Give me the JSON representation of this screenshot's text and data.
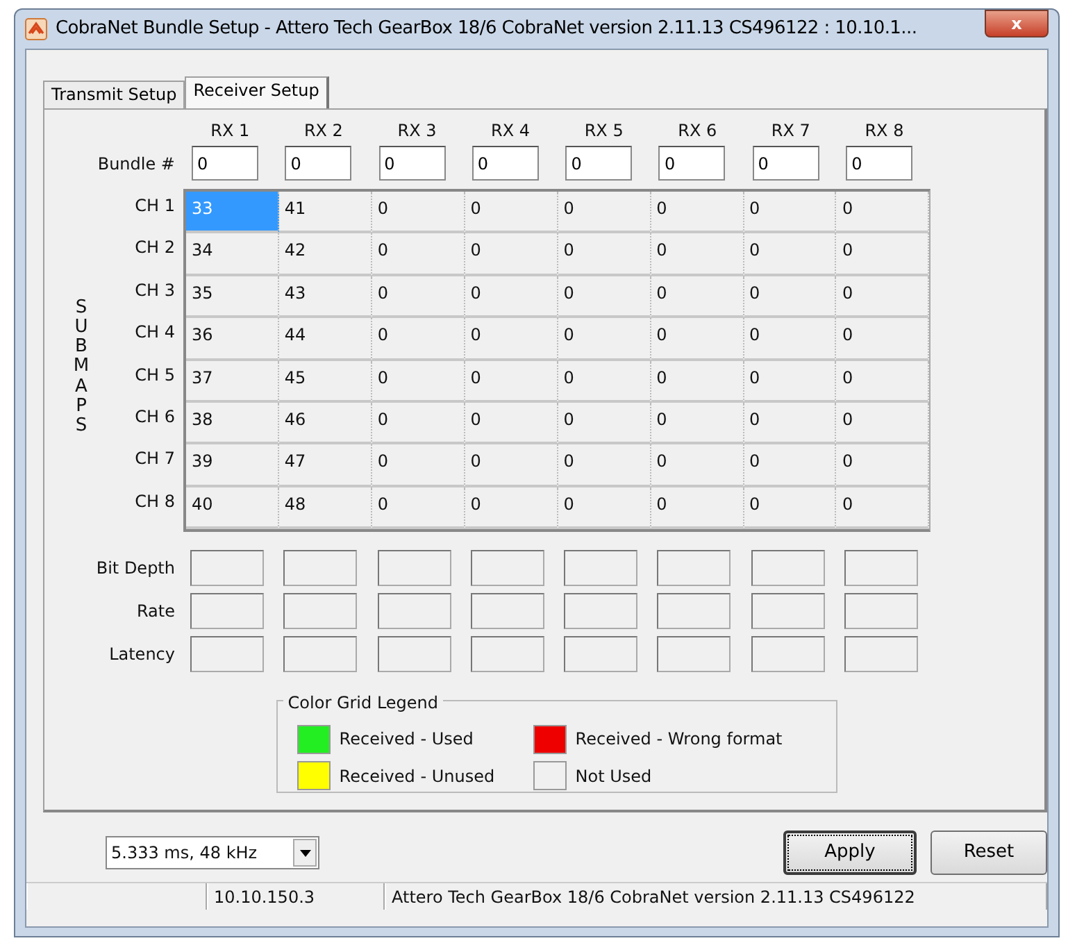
{
  "window": {
    "title": "CobraNet Bundle Setup - Attero Tech GearBox 18/6 CobraNet version 2.11.13 CS496122 : 10.10.1...",
    "close": "x"
  },
  "tabs": [
    {
      "label": "Transmit Setup",
      "selected": false
    },
    {
      "label": "Receiver Setup",
      "selected": true
    }
  ],
  "columns": [
    "RX 1",
    "RX 2",
    "RX 3",
    "RX 4",
    "RX 5",
    "RX 6",
    "RX 7",
    "RX 8"
  ],
  "bundle": {
    "label": "Bundle #",
    "values": [
      "0",
      "0",
      "0",
      "0",
      "0",
      "0",
      "0",
      "0"
    ]
  },
  "submaps": {
    "label": "SUBMAPS",
    "rows": [
      {
        "label": "CH 1",
        "cells": [
          {
            "value": "33",
            "selected": true
          },
          {
            "value": "41",
            "selected": false
          },
          {
            "value": "0",
            "selected": false
          },
          {
            "value": "0",
            "selected": false
          },
          {
            "value": "0",
            "selected": false
          },
          {
            "value": "0",
            "selected": false
          },
          {
            "value": "0",
            "selected": false
          },
          {
            "value": "0",
            "selected": false
          }
        ]
      },
      {
        "label": "CH 2",
        "cells": [
          {
            "value": "34",
            "selected": false
          },
          {
            "value": "42",
            "selected": false
          },
          {
            "value": "0",
            "selected": false
          },
          {
            "value": "0",
            "selected": false
          },
          {
            "value": "0",
            "selected": false
          },
          {
            "value": "0",
            "selected": false
          },
          {
            "value": "0",
            "selected": false
          },
          {
            "value": "0",
            "selected": false
          }
        ]
      },
      {
        "label": "CH 3",
        "cells": [
          {
            "value": "35",
            "selected": false
          },
          {
            "value": "43",
            "selected": false
          },
          {
            "value": "0",
            "selected": false
          },
          {
            "value": "0",
            "selected": false
          },
          {
            "value": "0",
            "selected": false
          },
          {
            "value": "0",
            "selected": false
          },
          {
            "value": "0",
            "selected": false
          },
          {
            "value": "0",
            "selected": false
          }
        ]
      },
      {
        "label": "CH 4",
        "cells": [
          {
            "value": "36",
            "selected": false
          },
          {
            "value": "44",
            "selected": false
          },
          {
            "value": "0",
            "selected": false
          },
          {
            "value": "0",
            "selected": false
          },
          {
            "value": "0",
            "selected": false
          },
          {
            "value": "0",
            "selected": false
          },
          {
            "value": "0",
            "selected": false
          },
          {
            "value": "0",
            "selected": false
          }
        ]
      },
      {
        "label": "CH 5",
        "cells": [
          {
            "value": "37",
            "selected": false
          },
          {
            "value": "45",
            "selected": false
          },
          {
            "value": "0",
            "selected": false
          },
          {
            "value": "0",
            "selected": false
          },
          {
            "value": "0",
            "selected": false
          },
          {
            "value": "0",
            "selected": false
          },
          {
            "value": "0",
            "selected": false
          },
          {
            "value": "0",
            "selected": false
          }
        ]
      },
      {
        "label": "CH 6",
        "cells": [
          {
            "value": "38",
            "selected": false
          },
          {
            "value": "46",
            "selected": false
          },
          {
            "value": "0",
            "selected": false
          },
          {
            "value": "0",
            "selected": false
          },
          {
            "value": "0",
            "selected": false
          },
          {
            "value": "0",
            "selected": false
          },
          {
            "value": "0",
            "selected": false
          },
          {
            "value": "0",
            "selected": false
          }
        ]
      },
      {
        "label": "CH 7",
        "cells": [
          {
            "value": "39",
            "selected": false
          },
          {
            "value": "47",
            "selected": false
          },
          {
            "value": "0",
            "selected": false
          },
          {
            "value": "0",
            "selected": false
          },
          {
            "value": "0",
            "selected": false
          },
          {
            "value": "0",
            "selected": false
          },
          {
            "value": "0",
            "selected": false
          },
          {
            "value": "0",
            "selected": false
          }
        ]
      },
      {
        "label": "CH 8",
        "cells": [
          {
            "value": "40",
            "selected": false
          },
          {
            "value": "48",
            "selected": false
          },
          {
            "value": "0",
            "selected": false
          },
          {
            "value": "0",
            "selected": false
          },
          {
            "value": "0",
            "selected": false
          },
          {
            "value": "0",
            "selected": false
          },
          {
            "value": "0",
            "selected": false
          },
          {
            "value": "0",
            "selected": false
          }
        ]
      }
    ]
  },
  "info_rows": [
    {
      "label": "Bit Depth"
    },
    {
      "label": "Rate"
    },
    {
      "label": "Latency"
    }
  ],
  "legend": {
    "title": "Color Grid Legend",
    "items": [
      {
        "label": "Received - Used",
        "color": "#22ee22"
      },
      {
        "label": "Received - Wrong format",
        "color": "#ee0000"
      },
      {
        "label": "Received - Unused",
        "color": "#ffff00"
      },
      {
        "label": "Not Used",
        "color": "#f0f0f0"
      }
    ]
  },
  "latency_select": {
    "value": "5.333 ms, 48 kHz"
  },
  "buttons": [
    {
      "label": "Apply",
      "focused": true
    },
    {
      "label": "Reset",
      "focused": false
    }
  ],
  "status_bar": [
    "10.10.150.3",
    "Attero Tech GearBox 18/6 CobraNet version 2.11.13 CS496122"
  ]
}
